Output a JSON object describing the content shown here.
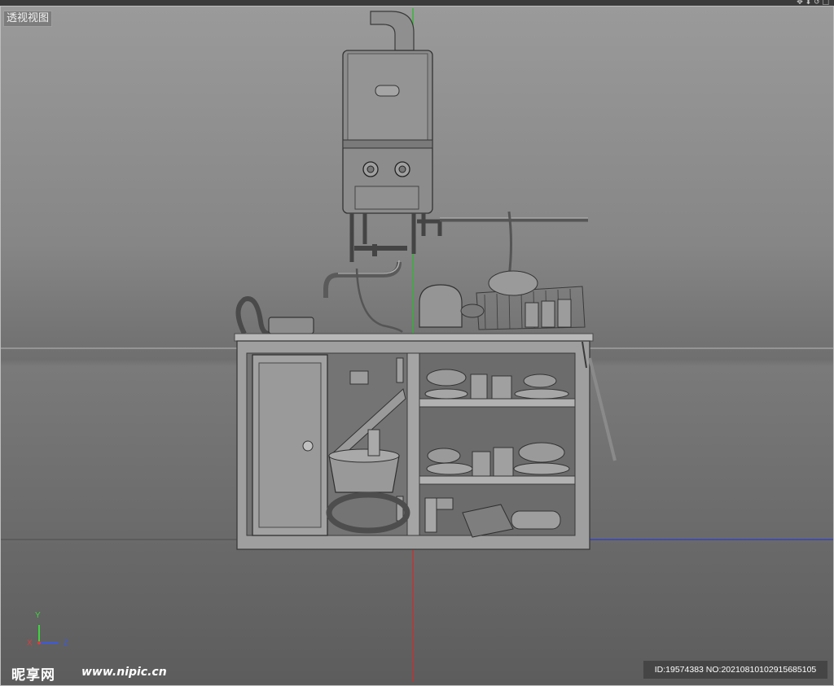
{
  "menubar": {
    "items": [
      "…",
      "…",
      "…",
      "…",
      "…"
    ],
    "right_icons": "✥ ⬇ ↺ □"
  },
  "viewport": {
    "label": "透视视图"
  },
  "axes": {
    "y": "Y",
    "x": "X",
    "z": "Z",
    "colors": {
      "y": "#3fd43f",
      "x": "#e03a3a",
      "z": "#3a5ae0"
    }
  },
  "watermark": {
    "site": "昵享网",
    "url": "www.nipic.cn"
  },
  "image_id": "ID:19574383 NO:20210810102915685105",
  "icons": {
    "axis_gizmo": "axis-gizmo-icon"
  }
}
